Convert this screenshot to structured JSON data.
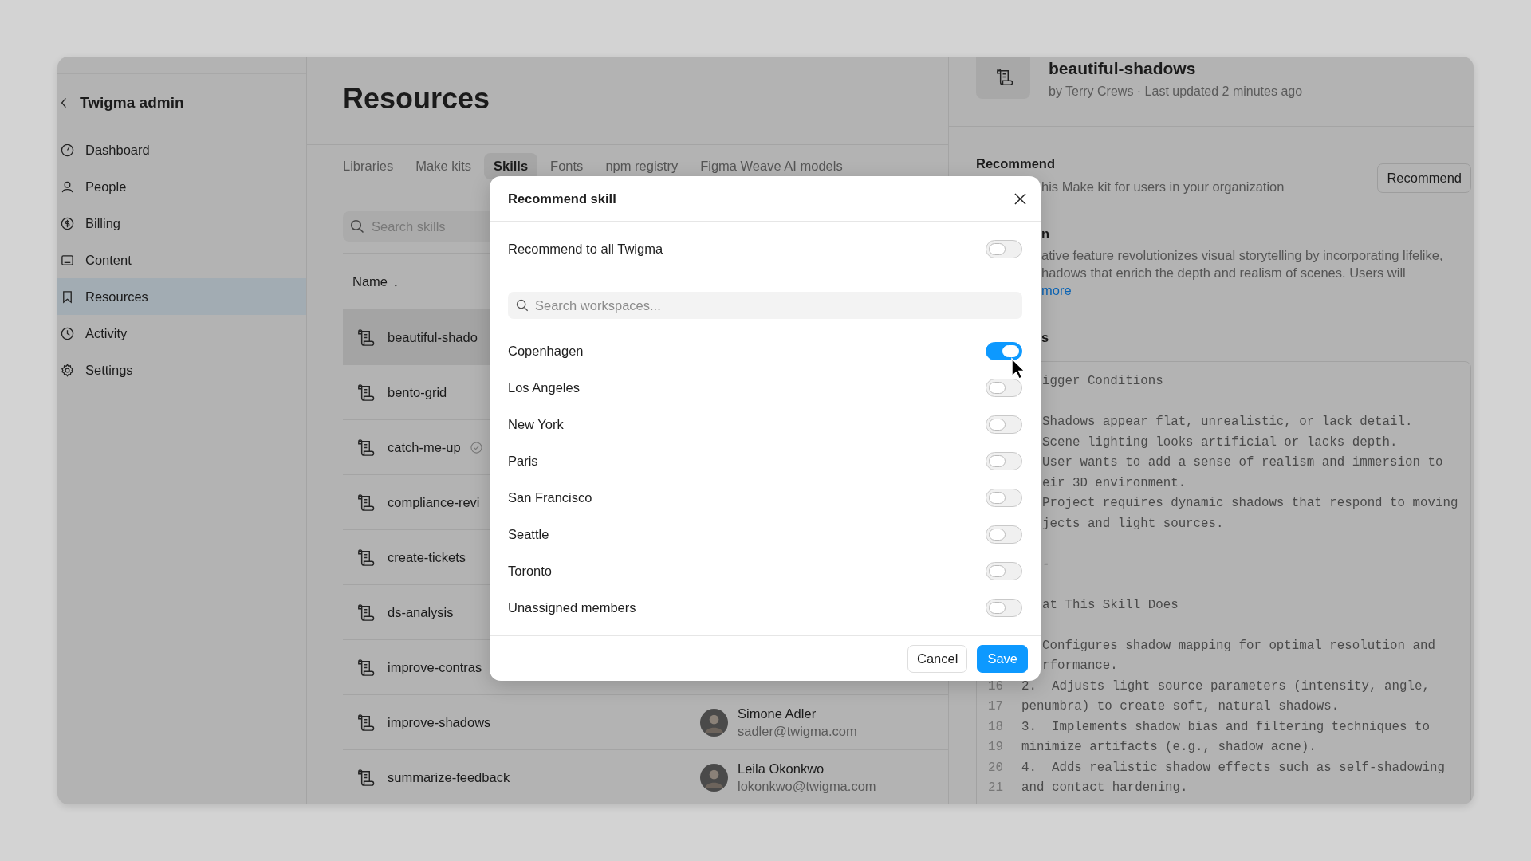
{
  "sidebar": {
    "title": "Twigma admin",
    "items": [
      {
        "label": "Dashboard",
        "selected": false
      },
      {
        "label": "People",
        "selected": false
      },
      {
        "label": "Billing",
        "selected": false
      },
      {
        "label": "Content",
        "selected": false
      },
      {
        "label": "Resources",
        "selected": true
      },
      {
        "label": "Activity",
        "selected": false
      },
      {
        "label": "Settings",
        "selected": false
      }
    ]
  },
  "main": {
    "title": "Resources",
    "tabs": [
      {
        "label": "Libraries",
        "selected": false
      },
      {
        "label": "Make kits",
        "selected": false
      },
      {
        "label": "Skills",
        "selected": true
      },
      {
        "label": "Fonts",
        "selected": false
      },
      {
        "label": "npm registry",
        "selected": false
      },
      {
        "label": "Figma Weave AI models",
        "selected": false
      }
    ],
    "search": {
      "placeholder": "Search skills"
    },
    "table": {
      "columns": [
        {
          "label": "Name",
          "sort_arrow": "↓"
        }
      ],
      "rows": [
        {
          "name": "beautiful-shado",
          "selected": true
        },
        {
          "name": "bento-grid",
          "selected": false,
          "verified": false
        },
        {
          "name": "catch-me-up",
          "selected": false,
          "verified": true
        },
        {
          "name": "compliance-revi",
          "selected": false
        },
        {
          "name": "create-tickets",
          "selected": false,
          "verified": false
        },
        {
          "name": "ds-analysis",
          "selected": false,
          "verified": false
        },
        {
          "name": "improve-contras",
          "selected": false
        },
        {
          "name": "improve-shadows",
          "selected": false,
          "verified": false,
          "owner": {
            "name": "Simone Adler",
            "email": "sadler@twigma.com"
          }
        },
        {
          "name": "summarize-feedback",
          "selected": false,
          "verified": false,
          "owner": {
            "name": "Leila Okonkwo",
            "email": "lokonkwo@twigma.com"
          }
        }
      ]
    }
  },
  "detail": {
    "title": "beautiful-shadows",
    "byline": "by Terry Crews · Last updated 2 minutes ago",
    "recommend": {
      "heading": "Recommend",
      "text": "his Make kit for users in your organization",
      "button": "Recommend"
    },
    "description": {
      "heading": "n",
      "lines": [
        "ative feature revolutionizes visual storytelling by incorporating lifelike,",
        "hadows that enrich the depth and realism of scenes. Users will"
      ],
      "link": "more"
    },
    "instructions": {
      "heading": "s",
      "lines": [
        {
          "kind": "text",
          "text": "igger Conditions"
        },
        {
          "kind": "gap"
        },
        {
          "kind": "text",
          "text": "Shadows appear flat, unrealistic, or lack detail."
        },
        {
          "kind": "text",
          "text": "Scene lighting looks artificial or lacks depth."
        },
        {
          "kind": "text",
          "text": "User wants to add a sense of realism and immersion to"
        },
        {
          "kind": "text",
          "text": "eir 3D environment."
        },
        {
          "kind": "text",
          "text": "Project requires dynamic shadows that respond to moving"
        },
        {
          "kind": "text",
          "text": "jects and light sources."
        },
        {
          "kind": "gap"
        },
        {
          "kind": "text",
          "text": "-"
        },
        {
          "kind": "gap"
        },
        {
          "kind": "text",
          "text": "at This Skill Does"
        },
        {
          "kind": "gap"
        },
        {
          "kind": "text",
          "text": "Configures shadow mapping for optimal resolution and"
        },
        {
          "kind": "text",
          "text": "rformance."
        },
        {
          "kind": "numbered",
          "number": "16",
          "text": "2.  Adjusts light source parameters (intensity, angle,"
        },
        {
          "kind": "numbered",
          "number": "17",
          "text": "penumbra) to create soft, natural shadows."
        },
        {
          "kind": "numbered",
          "number": "18",
          "text": "3.  Implements shadow bias and filtering techniques to"
        },
        {
          "kind": "numbered",
          "number": "19",
          "text": "minimize artifacts (e.g., shadow acne)."
        },
        {
          "kind": "numbered",
          "number": "20",
          "text": "4.  Adds realistic shadow effects such as self-shadowing"
        },
        {
          "kind": "numbered",
          "number": "21",
          "text": "and contact hardening."
        }
      ]
    }
  },
  "dialog": {
    "title": "Recommend skill",
    "recommend_all": {
      "label": "Recommend to all Twigma",
      "on": false
    },
    "search": {
      "placeholder": "Search workspaces..."
    },
    "workspaces": [
      {
        "label": "Copenhagen",
        "on": true
      },
      {
        "label": "Los Angeles",
        "on": false
      },
      {
        "label": "New York",
        "on": false
      },
      {
        "label": "Paris",
        "on": false
      },
      {
        "label": "San Francisco",
        "on": false
      },
      {
        "label": "Seattle",
        "on": false
      },
      {
        "label": "Toronto",
        "on": false
      },
      {
        "label": "Unassigned members",
        "on": false
      }
    ],
    "buttons": [
      {
        "label": "Cancel",
        "kind": "secondary"
      },
      {
        "label": "Save",
        "kind": "primary"
      }
    ]
  }
}
